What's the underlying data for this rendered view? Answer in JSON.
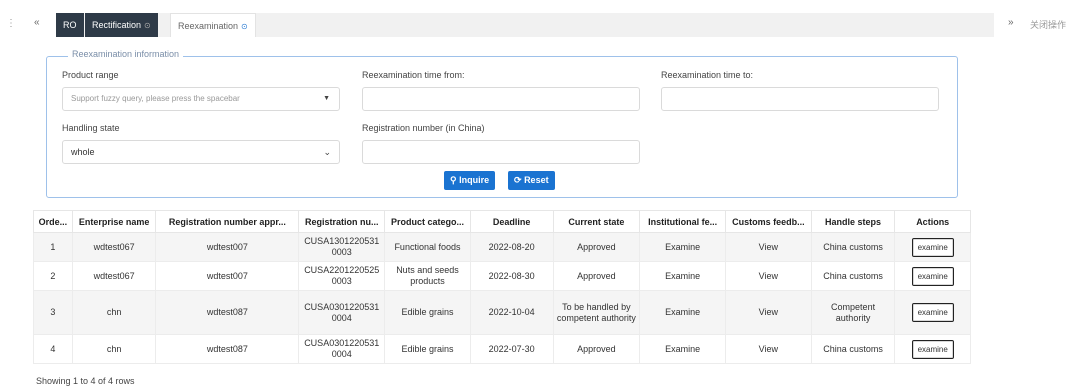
{
  "tabs": {
    "nav_left": "«",
    "nav_right": "»",
    "close_ops": "关闭操作",
    "items": [
      {
        "label": "RO"
      },
      {
        "label": "Rectification",
        "close": "⊙"
      },
      {
        "label": "Reexamination",
        "close": "⊙"
      }
    ]
  },
  "search": {
    "legend": "Reexamination information",
    "product_range_label": "Product range",
    "product_range_placeholder": "Support fuzzy query, please press the spacebar",
    "reexam_from_label": "Reexamination time from:",
    "reexam_to_label": "Reexamination time to:",
    "handling_state_label": "Handling state",
    "handling_state_value": "whole",
    "registration_number_label": "Registration number (in China)",
    "inquire_label": "Inquire",
    "reset_label": "Reset"
  },
  "table": {
    "headers": [
      "Orde...",
      "Enterprise name",
      "Registration number appr...",
      "Registration nu...",
      "Product catego...",
      "Deadline",
      "Current state",
      "Institutional fe...",
      "Customs feedb...",
      "Handle steps",
      "Actions"
    ],
    "rows": [
      {
        "order": "1",
        "enterprise": "wdtest067",
        "reg_approval": "wdtest007",
        "reg_number": "CUSA1301220531 0003",
        "category": "Functional foods",
        "deadline": "2022-08-20",
        "state": "Approved",
        "inst_feedback": "Examine",
        "customs_feedback": "View",
        "handle_steps": "China customs",
        "action": "examine"
      },
      {
        "order": "2",
        "enterprise": "wdtest067",
        "reg_approval": "wdtest007",
        "reg_number": "CUSA2201220525 0003",
        "category": "Nuts and seeds products",
        "deadline": "2022-08-30",
        "state": "Approved",
        "inst_feedback": "Examine",
        "customs_feedback": "View",
        "handle_steps": "China customs",
        "action": "examine"
      },
      {
        "order": "3",
        "enterprise": "chn",
        "reg_approval": "wdtest087",
        "reg_number": "CUSA0301220531 0004",
        "category": "Edible grains",
        "deadline": "2022-10-04",
        "state": "To be handled by competent authority",
        "inst_feedback": "Examine",
        "customs_feedback": "View",
        "handle_steps": "Competent authority",
        "action": "examine"
      },
      {
        "order": "4",
        "enterprise": "chn",
        "reg_approval": "wdtest087",
        "reg_number": "CUSA0301220531 0004",
        "category": "Edible grains",
        "deadline": "2022-07-30",
        "state": "Approved",
        "inst_feedback": "Examine",
        "customs_feedback": "View",
        "handle_steps": "China customs",
        "action": "examine"
      }
    ]
  },
  "footer": "Showing 1 to 4 of 4 rows",
  "colors": {
    "primary": "#1a73d1",
    "dark_tab": "#2e3a47",
    "panel_border": "#9ec1ea",
    "enterprise_link": "#c2792d"
  }
}
